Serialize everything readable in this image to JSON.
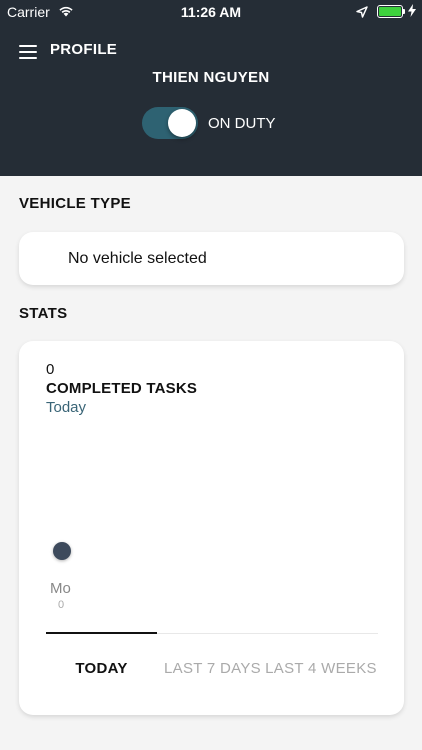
{
  "status_bar": {
    "carrier": "Carrier",
    "time": "11:26 AM",
    "battery_color": "#3ed13e"
  },
  "header": {
    "title": "PROFILE",
    "user_name": "THIEN NGUYEN",
    "duty_toggle_on": true,
    "duty_label": "ON DUTY"
  },
  "vehicle": {
    "section_label": "VEHICLE TYPE",
    "selected_text": "No vehicle selected"
  },
  "stats": {
    "section_label": "STATS",
    "count": "0",
    "label": "COMPLETED TASKS",
    "period": "Today",
    "chart_points": [
      {
        "day": "Mo",
        "value": "0"
      }
    ],
    "tabs": [
      {
        "label": "TODAY",
        "active": true
      },
      {
        "label": "LAST 7 DAYS",
        "active": false
      },
      {
        "label": "LAST 4 WEEKS",
        "active": false
      }
    ]
  },
  "colors": {
    "header_bg": "#252d36",
    "accent": "#2e6272",
    "period_text": "#3a6577"
  }
}
